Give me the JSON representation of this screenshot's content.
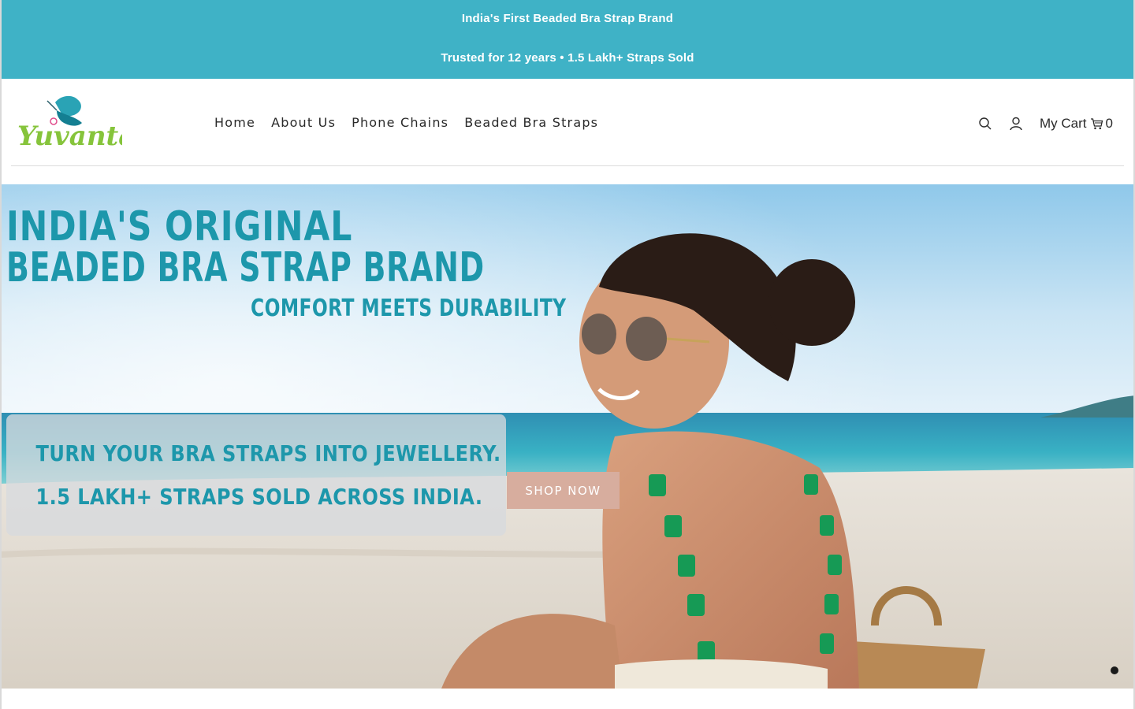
{
  "announcement": {
    "line1": "India's First Beaded Bra Strap Brand",
    "line2": "Trusted for 12 years • 1.5 Lakh+ Straps Sold",
    "background": "#3fb2c6"
  },
  "header": {
    "logo_text": "Yuvanta",
    "nav": [
      {
        "label": "Home"
      },
      {
        "label": "About Us"
      },
      {
        "label": "Phone Chains"
      },
      {
        "label": "Beaded Bra Straps"
      }
    ],
    "icons": {
      "search": "search-icon",
      "account": "user-icon",
      "cart": "cart-icon"
    },
    "cart_label": "My Cart",
    "cart_count": "0"
  },
  "hero": {
    "headline_1": "INDIA'S ORIGINAL",
    "headline_2": "BEADED BRA STRAP BRAND",
    "subhead": "COMFORT MEETS DURABILITY",
    "promo_1": "TURN YOUR BRA STRAPS INTO JEWELLERY.",
    "promo_2": "1.5 LAKH+ STRAPS SOLD ACROSS INDIA.",
    "cta": "SHOP NOW",
    "accent_color": "#1d97ab",
    "cta_color": "#d7ad9e"
  }
}
